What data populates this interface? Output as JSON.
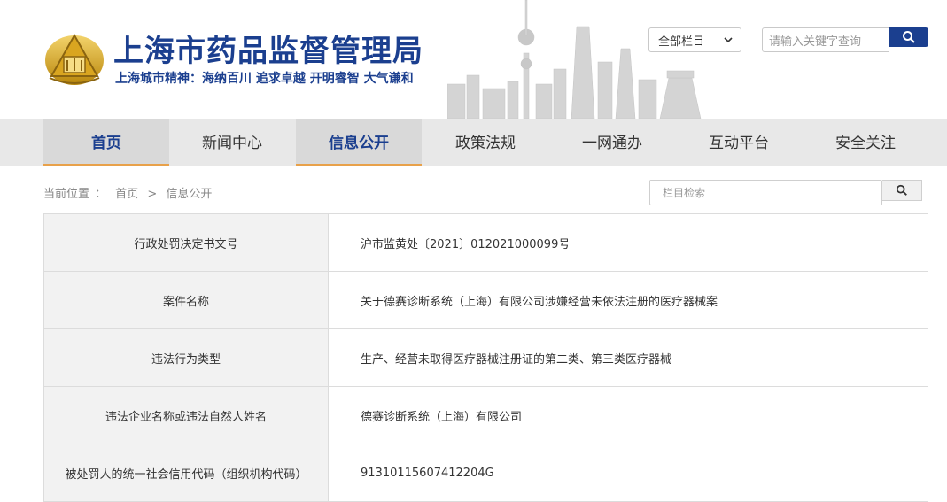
{
  "header": {
    "title": "上海市药品监督管理局",
    "slogan": "上海城市精神：海纳百川  追求卓越  开明睿智  大气谦和",
    "scope_select": "全部栏目",
    "search_placeholder": "请输入关键字查询"
  },
  "nav": {
    "items": [
      {
        "label": "首页"
      },
      {
        "label": "新闻中心"
      },
      {
        "label": "信息公开"
      },
      {
        "label": "政策法规"
      },
      {
        "label": "一网通办"
      },
      {
        "label": "互动平台"
      },
      {
        "label": "安全关注"
      }
    ]
  },
  "breadcrumb": {
    "prefix": "当前位置",
    "sep": "：",
    "home": "首页",
    "arrow": ">",
    "current": "信息公开"
  },
  "column_search": {
    "placeholder": "栏目检索"
  },
  "table": {
    "rows": [
      {
        "label": "行政处罚决定书文号",
        "value": "沪市监黄处〔2021〕012021000099号"
      },
      {
        "label": "案件名称",
        "value": "关于德赛诊断系统（上海）有限公司涉嫌经营未依法注册的医疗器械案"
      },
      {
        "label": "违法行为类型",
        "value": "生产、经营未取得医疗器械注册证的第二类、第三类医疗器械"
      },
      {
        "label": "违法企业名称或违法自然人姓名",
        "value": "德赛诊断系统（上海）有限公司"
      },
      {
        "label": "被处罚人的统一社会信用代码（组织机构代码）",
        "value": "91310115607412204G"
      }
    ]
  },
  "colors": {
    "brand_blue": "#1b3f8f",
    "accent_orange": "#e8a14a",
    "logo_gold": "#c9971e"
  }
}
